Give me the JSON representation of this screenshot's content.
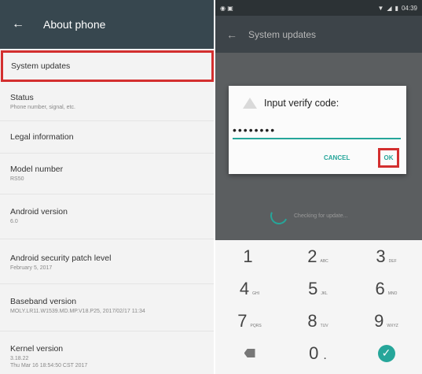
{
  "left": {
    "header_title": "About phone",
    "items": [
      {
        "title": "System updates",
        "sub": ""
      },
      {
        "title": "Status",
        "sub": "Phone number, signal, etc."
      },
      {
        "title": "Legal information",
        "sub": ""
      },
      {
        "title": "Model number",
        "sub": "RS50"
      },
      {
        "title": "Android version",
        "sub": "6.0"
      },
      {
        "title": "Android security patch level",
        "sub": "February 5, 2017"
      },
      {
        "title": "Baseband version",
        "sub": "MOLY.LR11.W1539.MD.MP.V18.P25, 2017/02/17 11:34"
      },
      {
        "title": "Kernel version",
        "sub": "3.18.22\nThu Mar 16 18:54:50 CST 2017"
      }
    ]
  },
  "right": {
    "status_time": "04:39",
    "header_title": "System updates",
    "dialog": {
      "title": "Input verify code:",
      "input_value": "••••••••",
      "cancel_label": "CANCEL",
      "ok_label": "OK"
    },
    "checking_text": "Checking for update...",
    "keypad": [
      [
        {
          "n": "1",
          "l": ""
        },
        {
          "n": "2",
          "l": "ABC"
        },
        {
          "n": "3",
          "l": "DEF"
        }
      ],
      [
        {
          "n": "4",
          "l": "GHI"
        },
        {
          "n": "5",
          "l": "JKL"
        },
        {
          "n": "6",
          "l": "MNO"
        }
      ],
      [
        {
          "n": "7",
          "l": "PQRS"
        },
        {
          "n": "8",
          "l": "TUV"
        },
        {
          "n": "9",
          "l": "WXYZ"
        }
      ],
      [
        {
          "n": "",
          "l": "",
          "icon": "backspace-icon"
        },
        {
          "n": "0",
          "l": "."
        },
        {
          "n": "",
          "l": "",
          "icon": "done-check-icon"
        }
      ]
    ]
  }
}
